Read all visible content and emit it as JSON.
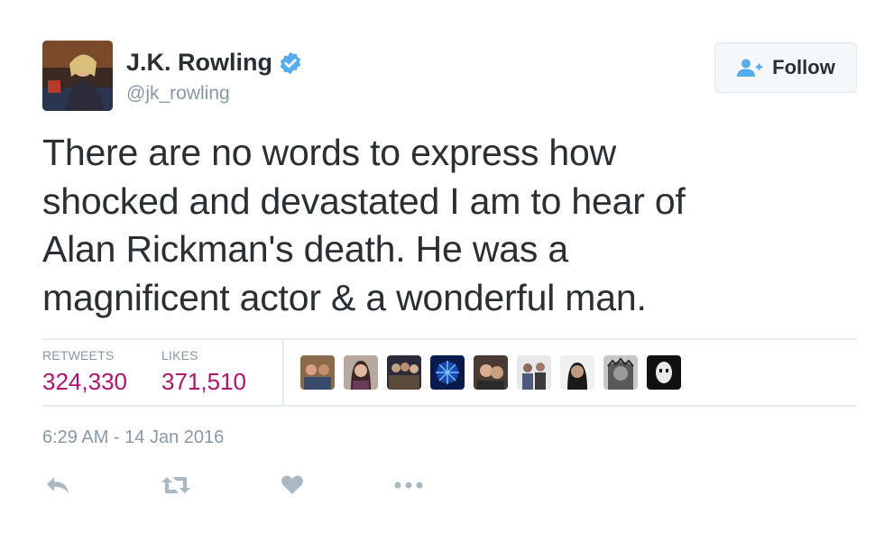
{
  "author": {
    "name": "J.K. Rowling",
    "handle": "@jk_rowling",
    "verified": true
  },
  "follow_button": {
    "label": "Follow",
    "icon": "add-person-icon"
  },
  "tweet": {
    "lines": [
      "There are no words to express how",
      "shocked and devastated I am to hear of",
      "Alan Rickman's death. He was a",
      "magnificent actor & a wonderful man."
    ]
  },
  "stats": {
    "retweets": {
      "label": "RETWEETS",
      "value": "324,330"
    },
    "likes": {
      "label": "LIKES",
      "value": "371,510"
    }
  },
  "liker_avatars": [
    "avatar-1",
    "avatar-2",
    "avatar-3",
    "avatar-4",
    "avatar-5",
    "avatar-6",
    "avatar-7",
    "avatar-8",
    "avatar-9"
  ],
  "timestamp": "6:29 AM - 14 Jan 2016",
  "actions": [
    "reply-icon",
    "retweet-icon",
    "like-heart-icon",
    "more-options-icon"
  ],
  "colors": {
    "accent": "#55acee",
    "count": "#b0156a",
    "text": "#292f33",
    "muted": "#8899a6"
  }
}
